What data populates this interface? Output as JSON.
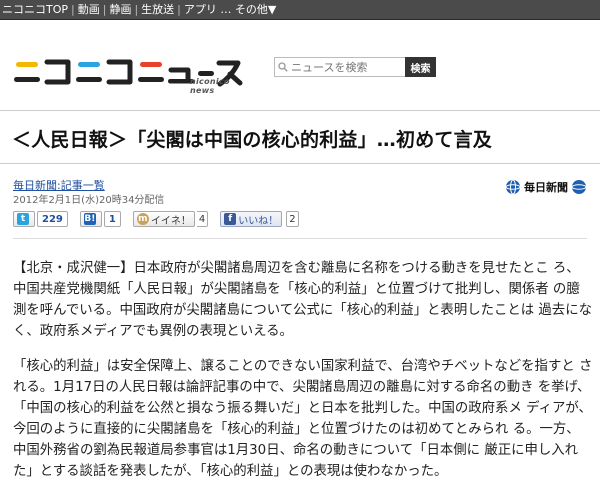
{
  "topnav": {
    "items": [
      "ニコニコTOP",
      "動画",
      "静画",
      "生放送",
      "アプリ … その他▼"
    ],
    "separator": "|"
  },
  "header": {
    "logo_text": "ニコニコニュース",
    "logo_en": "niconico news",
    "search_placeholder": "ニュースを検索",
    "search_button": "検索"
  },
  "article": {
    "headline": "＜人民日報＞「尖閣は中国の核心的利益」…初めて言及",
    "source_link": "毎日新聞:記事一覧",
    "date": "2012年2月1日(水)20時34分配信",
    "publisher_logo": "毎日新聞",
    "share": {
      "tweet_count": "229",
      "hatena_count": "1",
      "mixi_label": "イイネ！",
      "mixi_count": "4",
      "facebook_label": "いいね！",
      "facebook_count": "2"
    },
    "paragraphs": [
      "【北京・成沢健一】日本政府が尖閣諸島周辺を含む離島に名称をつける動きを見せたとこ ろ、中国共産党機関紙「人民日報」が尖閣諸島を「核心的利益」と位置づけて批判し、関係者 の臆測を呼んでいる。中国政府が尖閣諸島について公式に「核心的利益」と表明したことは 過去になく、政府系メディアでも異例の表現といえる。",
      "「核心的利益」は安全保障上、譲ることのできない国家利益で、台湾やチベットなどを指すと される。1月17日の人民日報は論評記事の中で、尖閣諸島周辺の離島に対する命名の動き を挙げ、「中国の核心的利益を公然と損なう振る舞いだ」と日本を批判した。中国の政府系メ ディアが、今回のように直接的に尖閣諸島を「核心的利益」と位置づけたのは初めてとみられ る。一方、中国外務省の劉為民報道局参事官は1月30日、命名の動きについて「日本側に 厳正に申し入れた」とする談話を発表したが、「核心的利益」との表現は使わなかった。"
    ]
  },
  "colors": {
    "topbar_bg": "#4b4b4b",
    "link": "#1f4fa0",
    "logo_dark": "#222222",
    "logo_accent_yellow": "#f2b800",
    "logo_accent_blue": "#2aa4e0",
    "logo_accent_red": "#e8412c"
  },
  "icons": [
    "search-icon",
    "twitter-icon",
    "hatena-icon",
    "mixi-icon",
    "facebook-icon",
    "mainichi-logo-icon"
  ]
}
